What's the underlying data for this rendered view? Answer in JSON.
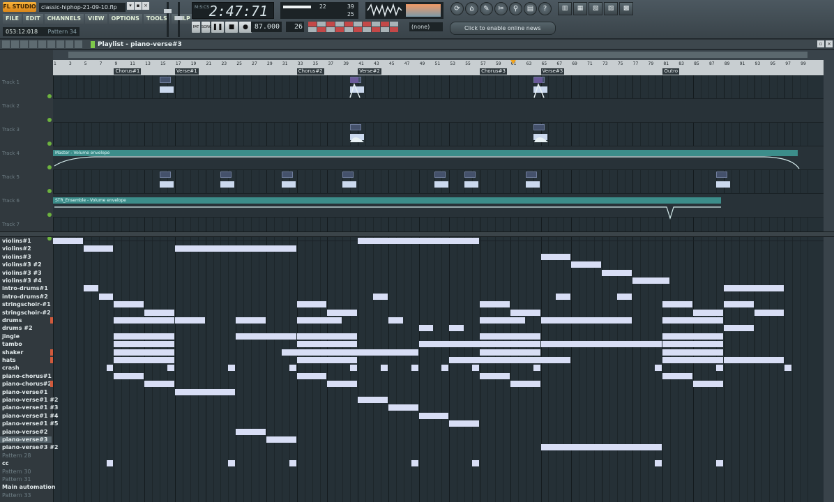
{
  "app": {
    "logo": "FL STUDIO",
    "filename": "classic-hiphop-21-09-10.flp",
    "win_buttons": [
      "▾",
      "▪",
      "×"
    ]
  },
  "menu": [
    "FILE",
    "EDIT",
    "CHANNELS",
    "VIEW",
    "OPTIONS",
    "TOOLS",
    "HELP"
  ],
  "status": {
    "position": "053:12:018",
    "pattern": "Pattern 34"
  },
  "clock": {
    "label": "M:S:CS",
    "time": "2:47:71"
  },
  "cpu": {
    "n1": "22",
    "n2": "39",
    "n3": "25"
  },
  "transport": {
    "pat_label": "PAT",
    "song_label": "SONG",
    "pause": "❚❚",
    "stop": "■",
    "record": "●"
  },
  "tempo": "87.000",
  "pattern_number": "26",
  "snap_select": "(none)",
  "news": "Click to enable online news",
  "tool_icons": [
    "⟳",
    "⌂",
    "✎",
    "✂",
    "⚲",
    "▤",
    "?"
  ],
  "window_icons": [
    "▥",
    "▦",
    "▧",
    "▨",
    "▩"
  ],
  "playlist": {
    "title": "Playlist - piano-verse#3",
    "ruler_numbers": [
      "1",
      "3",
      "5",
      "7",
      "9",
      "11",
      "13",
      "15",
      "17",
      "19",
      "21",
      "23",
      "25",
      "27",
      "29",
      "31",
      "33",
      "35",
      "37",
      "39",
      "41",
      "43",
      "45",
      "47",
      "49",
      "51",
      "53",
      "55",
      "57",
      "59",
      "61",
      "63",
      "65",
      "67",
      "69",
      "71",
      "73",
      "75",
      "77",
      "79",
      "81",
      "83",
      "85",
      "87",
      "89",
      "91",
      "93",
      "95",
      "97",
      "99"
    ],
    "markers": [
      {
        "label": "Chorus#1",
        "bar": 9
      },
      {
        "label": "Verse#1",
        "bar": 17
      },
      {
        "label": "Chorus#2",
        "bar": 33
      },
      {
        "label": "Verse#2",
        "bar": 41
      },
      {
        "label": "Chorus#3",
        "bar": 57
      },
      {
        "label": "Verse#3",
        "bar": 65
      },
      {
        "label": "Outro",
        "bar": 81
      }
    ],
    "tracks": [
      "Track 1",
      "Track 2",
      "Track 3",
      "Track 4",
      "Track 5",
      "Track 6",
      "Track 7"
    ],
    "track4_env": "Master - Volume envelope",
    "track6_env": "STR_Ensemble - Volume envelope"
  },
  "patterns": [
    {
      "name": "violins#1",
      "dim": false,
      "mark": false
    },
    {
      "name": "violins#2",
      "dim": false,
      "mark": false
    },
    {
      "name": "violins#3",
      "dim": false,
      "mark": false
    },
    {
      "name": "violins#3 #2",
      "dim": false,
      "mark": false
    },
    {
      "name": "violins#3 #3",
      "dim": false,
      "mark": false
    },
    {
      "name": "violins#3 #4",
      "dim": false,
      "mark": false
    },
    {
      "name": "intro-drums#1",
      "dim": false,
      "mark": false
    },
    {
      "name": "intro-drums#2",
      "dim": false,
      "mark": false
    },
    {
      "name": "stringschoir-#1",
      "dim": false,
      "mark": false
    },
    {
      "name": "stringschoir-#2",
      "dim": false,
      "mark": false
    },
    {
      "name": "drums",
      "dim": false,
      "mark": true
    },
    {
      "name": "drums #2",
      "dim": false,
      "mark": false
    },
    {
      "name": "jingle",
      "dim": false,
      "mark": false
    },
    {
      "name": "tambo",
      "dim": false,
      "mark": false
    },
    {
      "name": "shaker",
      "dim": false,
      "mark": true
    },
    {
      "name": "hats",
      "dim": false,
      "mark": true
    },
    {
      "name": "crash",
      "dim": false,
      "mark": false
    },
    {
      "name": "piano-chorus#1",
      "dim": false,
      "mark": false
    },
    {
      "name": "piano-chorus#2",
      "dim": false,
      "mark": true
    },
    {
      "name": "piano-verse#1",
      "dim": false,
      "mark": false
    },
    {
      "name": "piano-verse#1 #2",
      "dim": false,
      "mark": false
    },
    {
      "name": "piano-verse#1 #3",
      "dim": false,
      "mark": false
    },
    {
      "name": "piano-verse#1 #4",
      "dim": false,
      "mark": false
    },
    {
      "name": "piano-verse#1 #5",
      "dim": false,
      "mark": false
    },
    {
      "name": "piano-verse#2",
      "dim": false,
      "mark": false
    },
    {
      "name": "piano-verse#3",
      "dim": false,
      "mark": false,
      "selected": true
    },
    {
      "name": "piano-verse#3 #2",
      "dim": false,
      "mark": false
    },
    {
      "name": "Pattern 28",
      "dim": true,
      "mark": false
    },
    {
      "name": "cc",
      "dim": false,
      "mark": false
    },
    {
      "name": "Pattern 30",
      "dim": true,
      "mark": false
    },
    {
      "name": "Pattern 31",
      "dim": true,
      "mark": false
    },
    {
      "name": "Main automation",
      "dim": false,
      "mark": false
    },
    {
      "name": "Pattern 33",
      "dim": true,
      "mark": false
    }
  ],
  "pattern_clips": [
    {
      "row": 0,
      "start": 1,
      "len": 4
    },
    {
      "row": 0,
      "start": 41,
      "len": 16
    },
    {
      "row": 1,
      "start": 5,
      "len": 4
    },
    {
      "row": 1,
      "start": 17,
      "len": 16
    },
    {
      "row": 2,
      "start": 65,
      "len": 4
    },
    {
      "row": 3,
      "start": 69,
      "len": 4
    },
    {
      "row": 4,
      "start": 73,
      "len": 4
    },
    {
      "row": 5,
      "start": 77,
      "len": 5
    },
    {
      "row": 6,
      "start": 5,
      "len": 2
    },
    {
      "row": 6,
      "start": 89,
      "len": 8
    },
    {
      "row": 7,
      "start": 7,
      "len": 2
    },
    {
      "row": 7,
      "start": 43,
      "len": 2
    },
    {
      "row": 7,
      "start": 67,
      "len": 2
    },
    {
      "row": 7,
      "start": 75,
      "len": 2
    },
    {
      "row": 8,
      "start": 9,
      "len": 4
    },
    {
      "row": 8,
      "start": 33,
      "len": 4
    },
    {
      "row": 8,
      "start": 57,
      "len": 4
    },
    {
      "row": 8,
      "start": 81,
      "len": 4
    },
    {
      "row": 8,
      "start": 89,
      "len": 4
    },
    {
      "row": 9,
      "start": 13,
      "len": 4
    },
    {
      "row": 9,
      "start": 37,
      "len": 4
    },
    {
      "row": 9,
      "start": 61,
      "len": 4
    },
    {
      "row": 9,
      "start": 85,
      "len": 4
    },
    {
      "row": 9,
      "start": 93,
      "len": 4
    },
    {
      "row": 10,
      "start": 9,
      "len": 8
    },
    {
      "row": 10,
      "start": 17,
      "len": 4
    },
    {
      "row": 10,
      "start": 25,
      "len": 4
    },
    {
      "row": 10,
      "start": 33,
      "len": 6
    },
    {
      "row": 10,
      "start": 45,
      "len": 2
    },
    {
      "row": 10,
      "start": 57,
      "len": 6
    },
    {
      "row": 10,
      "start": 65,
      "len": 12
    },
    {
      "row": 10,
      "start": 81,
      "len": 8
    },
    {
      "row": 11,
      "start": 49,
      "len": 2
    },
    {
      "row": 11,
      "start": 53,
      "len": 2
    },
    {
      "row": 11,
      "start": 89,
      "len": 4
    },
    {
      "row": 12,
      "start": 9,
      "len": 8
    },
    {
      "row": 12,
      "start": 25,
      "len": 8
    },
    {
      "row": 12,
      "start": 33,
      "len": 8
    },
    {
      "row": 12,
      "start": 57,
      "len": 8
    },
    {
      "row": 12,
      "start": 81,
      "len": 8
    },
    {
      "row": 13,
      "start": 9,
      "len": 8
    },
    {
      "row": 13,
      "start": 33,
      "len": 8
    },
    {
      "row": 13,
      "start": 49,
      "len": 16
    },
    {
      "row": 13,
      "start": 57,
      "len": 8
    },
    {
      "row": 13,
      "start": 65,
      "len": 16
    },
    {
      "row": 13,
      "start": 81,
      "len": 8
    },
    {
      "row": 14,
      "start": 9,
      "len": 8
    },
    {
      "row": 14,
      "start": 31,
      "len": 18
    },
    {
      "row": 14,
      "start": 57,
      "len": 8
    },
    {
      "row": 14,
      "start": 81,
      "len": 8
    },
    {
      "row": 15,
      "start": 9,
      "len": 8
    },
    {
      "row": 15,
      "start": 33,
      "len": 8
    },
    {
      "row": 15,
      "start": 53,
      "len": 16
    },
    {
      "row": 15,
      "start": 81,
      "len": 8
    },
    {
      "row": 15,
      "start": 89,
      "len": 8
    },
    {
      "row": 16,
      "start": 8,
      "len": 1
    },
    {
      "row": 16,
      "start": 16,
      "len": 1
    },
    {
      "row": 16,
      "start": 24,
      "len": 1
    },
    {
      "row": 16,
      "start": 32,
      "len": 1
    },
    {
      "row": 16,
      "start": 40,
      "len": 1
    },
    {
      "row": 16,
      "start": 44,
      "len": 1
    },
    {
      "row": 16,
      "start": 48,
      "len": 1
    },
    {
      "row": 16,
      "start": 52,
      "len": 1
    },
    {
      "row": 16,
      "start": 56,
      "len": 1
    },
    {
      "row": 16,
      "start": 64,
      "len": 1
    },
    {
      "row": 16,
      "start": 80,
      "len": 1
    },
    {
      "row": 16,
      "start": 88,
      "len": 1
    },
    {
      "row": 16,
      "start": 97,
      "len": 1
    },
    {
      "row": 17,
      "start": 9,
      "len": 4
    },
    {
      "row": 17,
      "start": 33,
      "len": 4
    },
    {
      "row": 17,
      "start": 57,
      "len": 4
    },
    {
      "row": 17,
      "start": 81,
      "len": 4
    },
    {
      "row": 18,
      "start": 13,
      "len": 4
    },
    {
      "row": 18,
      "start": 37,
      "len": 4
    },
    {
      "row": 18,
      "start": 61,
      "len": 4
    },
    {
      "row": 18,
      "start": 85,
      "len": 4
    },
    {
      "row": 19,
      "start": 17,
      "len": 8
    },
    {
      "row": 20,
      "start": 41,
      "len": 4
    },
    {
      "row": 21,
      "start": 45,
      "len": 4
    },
    {
      "row": 22,
      "start": 49,
      "len": 4
    },
    {
      "row": 23,
      "start": 53,
      "len": 4
    },
    {
      "row": 24,
      "start": 25,
      "len": 4
    },
    {
      "row": 25,
      "start": 29,
      "len": 4
    },
    {
      "row": 26,
      "start": 65,
      "len": 16
    },
    {
      "row": 28,
      "start": 8,
      "len": 1
    },
    {
      "row": 28,
      "start": 24,
      "len": 1
    },
    {
      "row": 28,
      "start": 32,
      "len": 1
    },
    {
      "row": 28,
      "start": 48,
      "len": 1
    },
    {
      "row": 28,
      "start": 56,
      "len": 1
    },
    {
      "row": 28,
      "start": 80,
      "len": 1
    },
    {
      "row": 28,
      "start": 88,
      "len": 1
    }
  ],
  "track_clips": [
    {
      "track": 0,
      "bars": [
        15,
        40,
        64
      ]
    },
    {
      "track": 2,
      "bars": [
        40,
        64
      ]
    },
    {
      "track": 4,
      "bars": [
        15,
        23,
        31,
        39,
        51,
        55,
        63,
        88
      ]
    }
  ]
}
